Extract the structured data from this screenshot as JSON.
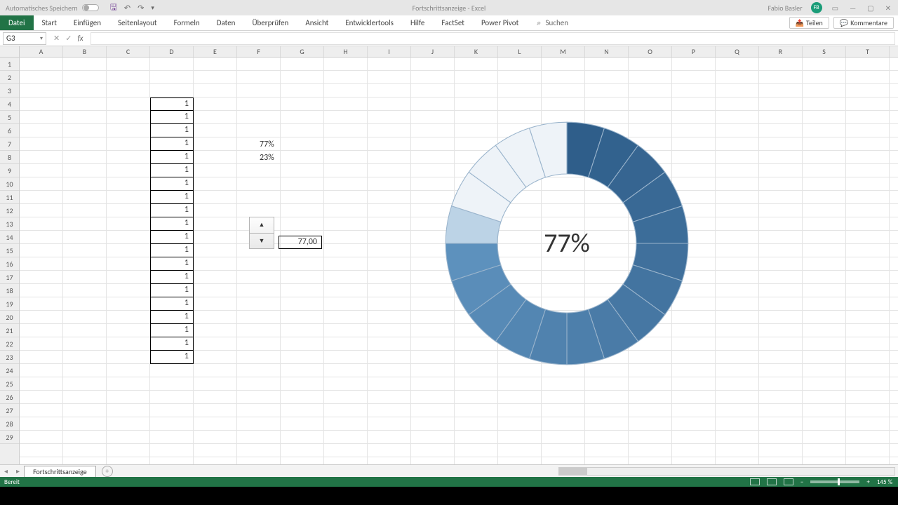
{
  "title": {
    "autosave": "Automatisches Speichern",
    "center": "Fortschrittsanzeige  -  Excel",
    "user": "Fabio Basler",
    "initials": "FB"
  },
  "ribbon": {
    "file": "Datei",
    "tabs": [
      "Start",
      "Einfügen",
      "Seitenlayout",
      "Formeln",
      "Daten",
      "Überprüfen",
      "Ansicht",
      "Entwicklertools",
      "Hilfe",
      "FactSet",
      "Power Pivot"
    ],
    "search": "Suchen",
    "share": "Teilen",
    "comments": "Kommentare"
  },
  "namebox": "G3",
  "columns": [
    "A",
    "B",
    "C",
    "D",
    "E",
    "F",
    "G",
    "H",
    "I",
    "J",
    "K",
    "L",
    "M",
    "N",
    "O",
    "P",
    "Q",
    "R",
    "S",
    "T"
  ],
  "rows": [
    "1",
    "2",
    "3",
    "4",
    "5",
    "6",
    "7",
    "8",
    "9",
    "10",
    "11",
    "12",
    "13",
    "14",
    "15",
    "16",
    "17",
    "18",
    "19",
    "20",
    "21",
    "22",
    "23",
    "24",
    "25",
    "26",
    "27",
    "28",
    "29"
  ],
  "colD": [
    "1",
    "1",
    "1",
    "1",
    "1",
    "1",
    "1",
    "1",
    "1",
    "1",
    "1",
    "1",
    "1",
    "1",
    "1",
    "1",
    "1",
    "1",
    "1",
    "1"
  ],
  "percent1": "77%",
  "percent2": "23%",
  "spinner": "77,00",
  "chart_center": "77%",
  "sheettab": "Fortschrittsanzeige",
  "status": {
    "ready": "Bereit",
    "zoom": "145 %"
  },
  "chart_data": {
    "type": "pie",
    "title": "Fortschrittsanzeige",
    "segments_total": 20,
    "percent_filled": 77,
    "center_label": "77%",
    "filled_color_range": [
      "#2f5e8a",
      "#6ea3cf"
    ],
    "empty_color": "#eef3f8"
  }
}
